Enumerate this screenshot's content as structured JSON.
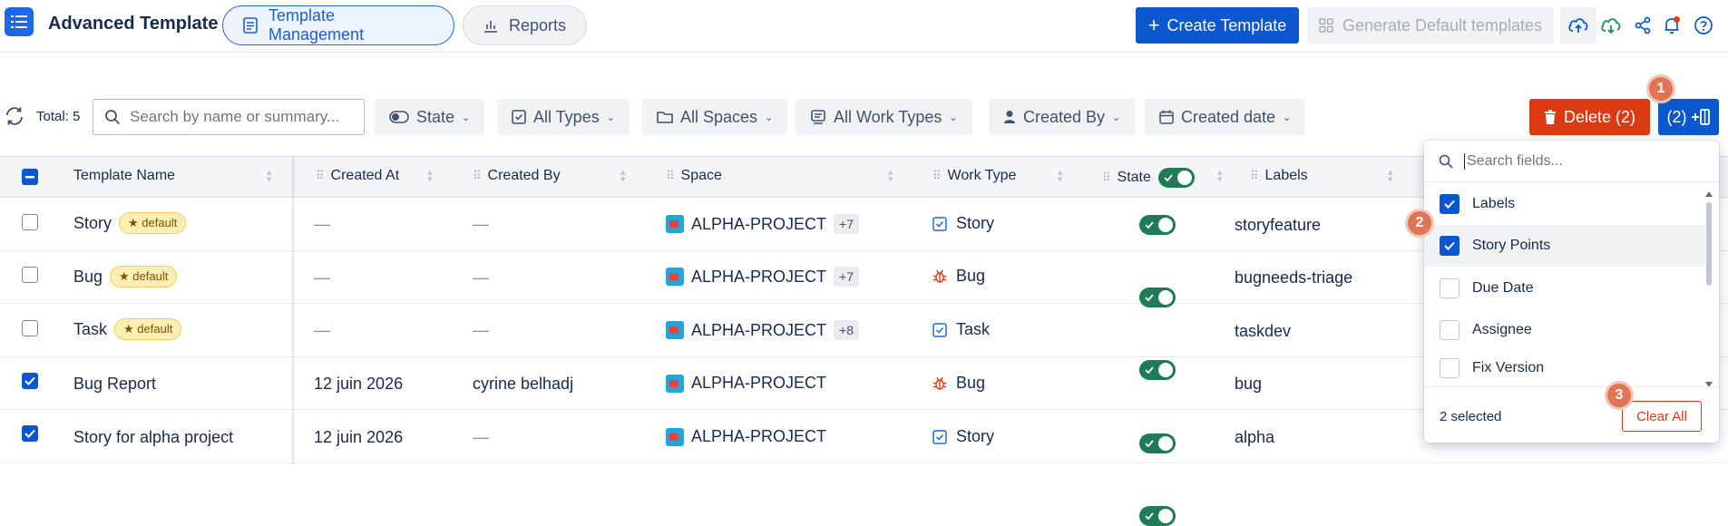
{
  "header": {
    "app_title": "Advanced Template",
    "tabs": [
      {
        "label": "Template Management",
        "active": true
      },
      {
        "label": "Reports",
        "active": false
      }
    ],
    "create_label": "Create Template",
    "generate_label": "Generate Default templates"
  },
  "toolbar": {
    "total_label": "Total: 5",
    "search_placeholder": "Search by name or summary...",
    "filters": [
      "State",
      "All Types",
      "All Spaces",
      "All Work Types",
      "Created By",
      "Created date"
    ],
    "delete_label": "Delete (2)",
    "columns_label": "(2)"
  },
  "steps": [
    "1",
    "2",
    "3"
  ],
  "table": {
    "columns": [
      "Template Name",
      "Created At",
      "Created By",
      "Space",
      "Work Type",
      "State",
      "Labels"
    ],
    "rows": [
      {
        "checked": false,
        "name": "Story",
        "badge": "★ default",
        "created_at": "—",
        "created_by": "—",
        "space": "ALPHA-PROJECT",
        "space_more": "+7",
        "work_type": "Story",
        "work_type_icon": "story-icon",
        "state_on": true,
        "labels": "storyfeature"
      },
      {
        "checked": false,
        "name": "Bug",
        "badge": "★ default",
        "created_at": "—",
        "created_by": "—",
        "space": "ALPHA-PROJECT",
        "space_more": "+7",
        "work_type": "Bug",
        "work_type_icon": "bug-icon",
        "state_on": true,
        "labels": "bugneeds-triage"
      },
      {
        "checked": false,
        "name": "Task",
        "badge": "★ default",
        "created_at": "—",
        "created_by": "—",
        "space": "ALPHA-PROJECT",
        "space_more": "+8",
        "work_type": "Task",
        "work_type_icon": "task-icon",
        "state_on": true,
        "labels": "taskdev"
      },
      {
        "checked": true,
        "name": "Bug Report",
        "badge": "",
        "created_at": "12 juin 2026",
        "created_by": "cyrine belhadj",
        "space": "ALPHA-PROJECT",
        "space_more": "",
        "work_type": "Bug",
        "work_type_icon": "bug-icon",
        "state_on": true,
        "labels": "bug"
      },
      {
        "checked": true,
        "name": "Story for alpha project",
        "badge": "",
        "created_at": "12 juin 2026",
        "created_by": "—",
        "space": "ALPHA-PROJECT",
        "space_more": "",
        "work_type": "Story",
        "work_type_icon": "story-icon",
        "state_on": true,
        "labels": "alpha"
      }
    ]
  },
  "field_panel": {
    "search_placeholder": "Search fields...",
    "options": [
      {
        "label": "Labels",
        "checked": true
      },
      {
        "label": "Story Points",
        "checked": true
      },
      {
        "label": "Due Date",
        "checked": false
      },
      {
        "label": "Assignee",
        "checked": false
      },
      {
        "label": "Fix Version",
        "checked": false
      }
    ],
    "selected_label": "2 selected",
    "clear_label": "Clear All"
  },
  "colors": {
    "primary": "#0b57d0",
    "danger": "#dc3a12",
    "toggle_on": "#1e7b53",
    "step_badge": "#e07456"
  }
}
